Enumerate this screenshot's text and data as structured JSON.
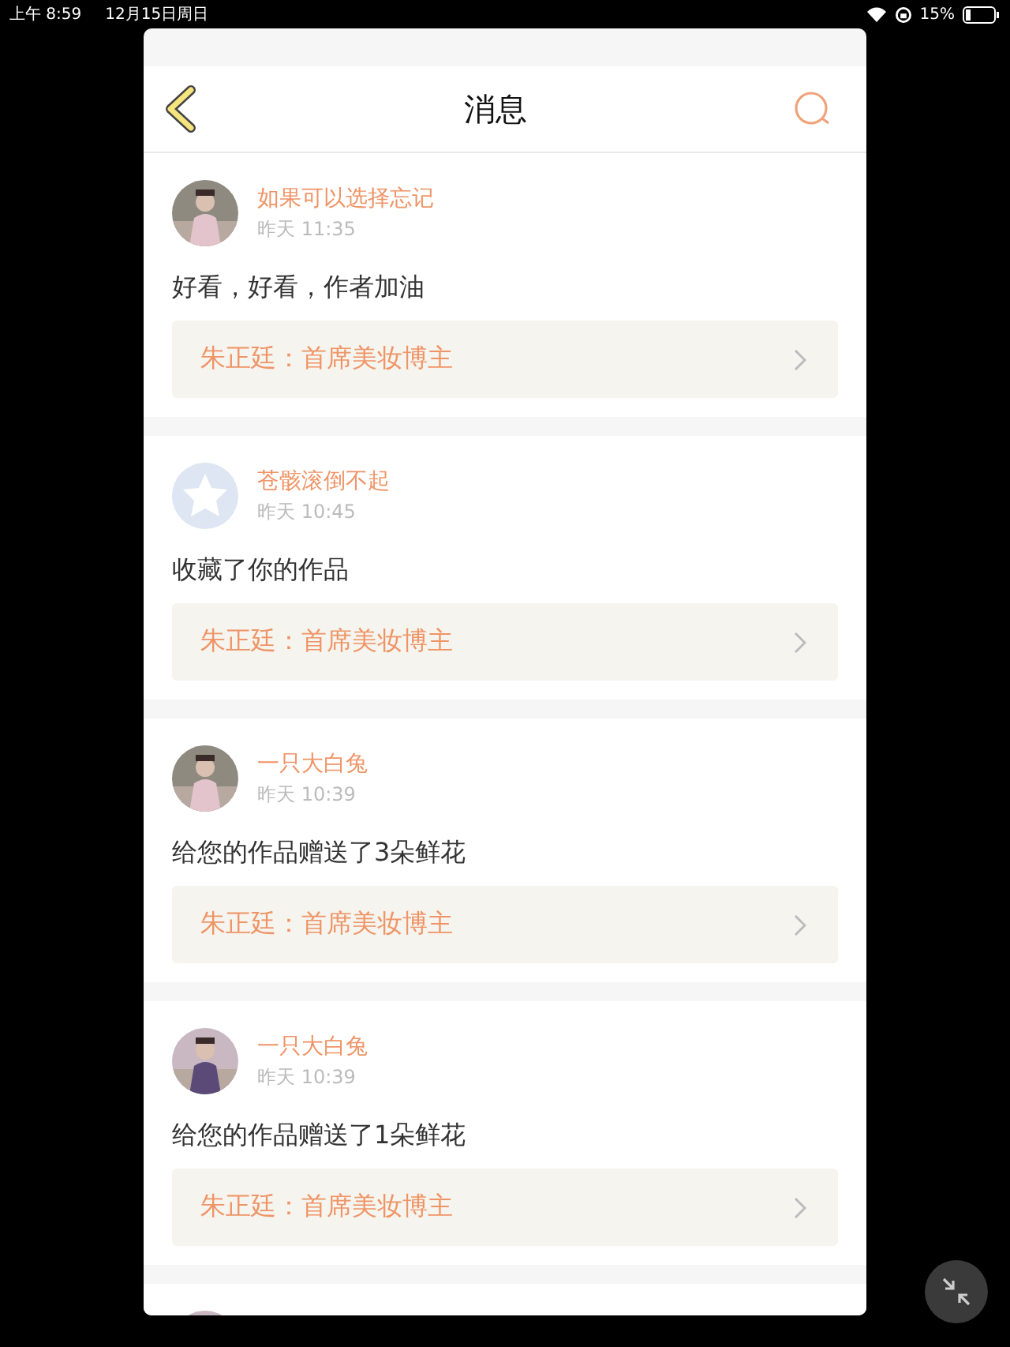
{
  "status_bar": {
    "time": "上午 8:59",
    "date": "12月15日周日",
    "battery": "15%"
  },
  "header": {
    "title": "消息"
  },
  "messages": [
    {
      "name": "如果可以选择忘记",
      "time": "昨天 11:35",
      "content": "好看，好看，作者加油",
      "work": "朱正廷：首席美妆博主"
    },
    {
      "avatar": {
        "kind": "default"
      },
      "name": "苍骸滚倒不起",
      "time": "昨天 10:45",
      "content": "收藏了你的作品",
      "work": "朱正廷：首席美妆博主"
    },
    {
      "name": "一只大白兔",
      "time": "昨天 10:39",
      "content": "给您的作品赠送了3朵鲜花",
      "work": "朱正廷：首席美妆博主"
    },
    {
      "name": "一只大白兔",
      "time": "昨天 10:39",
      "content": "给您的作品赠送了1朵鲜花",
      "work": "朱正廷：首席美妆博主"
    }
  ]
}
